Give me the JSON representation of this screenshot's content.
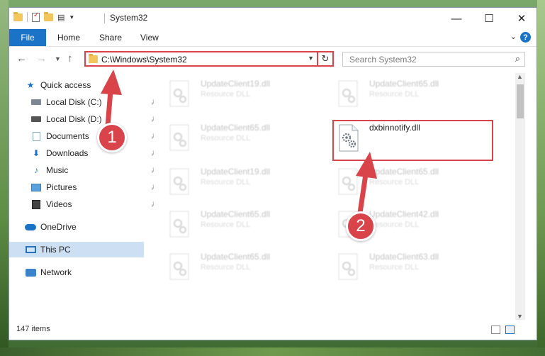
{
  "window": {
    "title": "System32",
    "minimize_glyph": "—",
    "maximize_glyph": "☐",
    "close_glyph": "✕"
  },
  "ribbon": {
    "file": "File",
    "home": "Home",
    "share": "Share",
    "view": "View",
    "help": "?"
  },
  "nav": {
    "address": "C:\\Windows\\System32",
    "search_placeholder": "Search System32"
  },
  "sidebar": {
    "items": [
      {
        "label": "Quick access",
        "icon": "star-icon"
      },
      {
        "label": "Local Disk (C:)",
        "icon": "drive-icon"
      },
      {
        "label": "Local Disk (D:)",
        "icon": "drive-icon"
      },
      {
        "label": "Documents",
        "icon": "documents-icon"
      },
      {
        "label": "Downloads",
        "icon": "downloads-icon"
      },
      {
        "label": "Music",
        "icon": "music-icon"
      },
      {
        "label": "Pictures",
        "icon": "pictures-icon"
      },
      {
        "label": "Videos",
        "icon": "videos-icon"
      },
      {
        "label": "OneDrive",
        "icon": "cloud-icon"
      },
      {
        "label": "This PC",
        "icon": "computer-icon"
      },
      {
        "label": "Network",
        "icon": "network-icon"
      }
    ]
  },
  "files": {
    "f0": {
      "name": "UpdateClient19.dll",
      "type": "Resource DLL"
    },
    "f1": {
      "name": "UpdateClient65.dll",
      "type": "Resource DLL"
    },
    "f2": {
      "name": "UpdateClient65.dll",
      "type": "Resource DLL"
    },
    "f3": {
      "name": "dxbinnotify.dll",
      "type": ""
    },
    "f4": {
      "name": "UpdateClient19.dll",
      "type": "Resource DLL"
    },
    "f5": {
      "name": "UpdateClient65.dll",
      "type": "Resource DLL"
    },
    "f6": {
      "name": "UpdateClient65.dll",
      "type": "Resource DLL"
    },
    "f7": {
      "name": "UpdateClient42.dll",
      "type": "Resource DLL"
    },
    "f8": {
      "name": "UpdateClient65.dll",
      "type": "Resource DLL"
    },
    "f9": {
      "name": "UpdateClient63.dll",
      "type": "Resource DLL"
    }
  },
  "status": {
    "count": "147 items"
  },
  "callouts": {
    "one": "1",
    "two": "2"
  },
  "colors": {
    "accent": "#1a73c6",
    "highlight": "#d9434a"
  }
}
